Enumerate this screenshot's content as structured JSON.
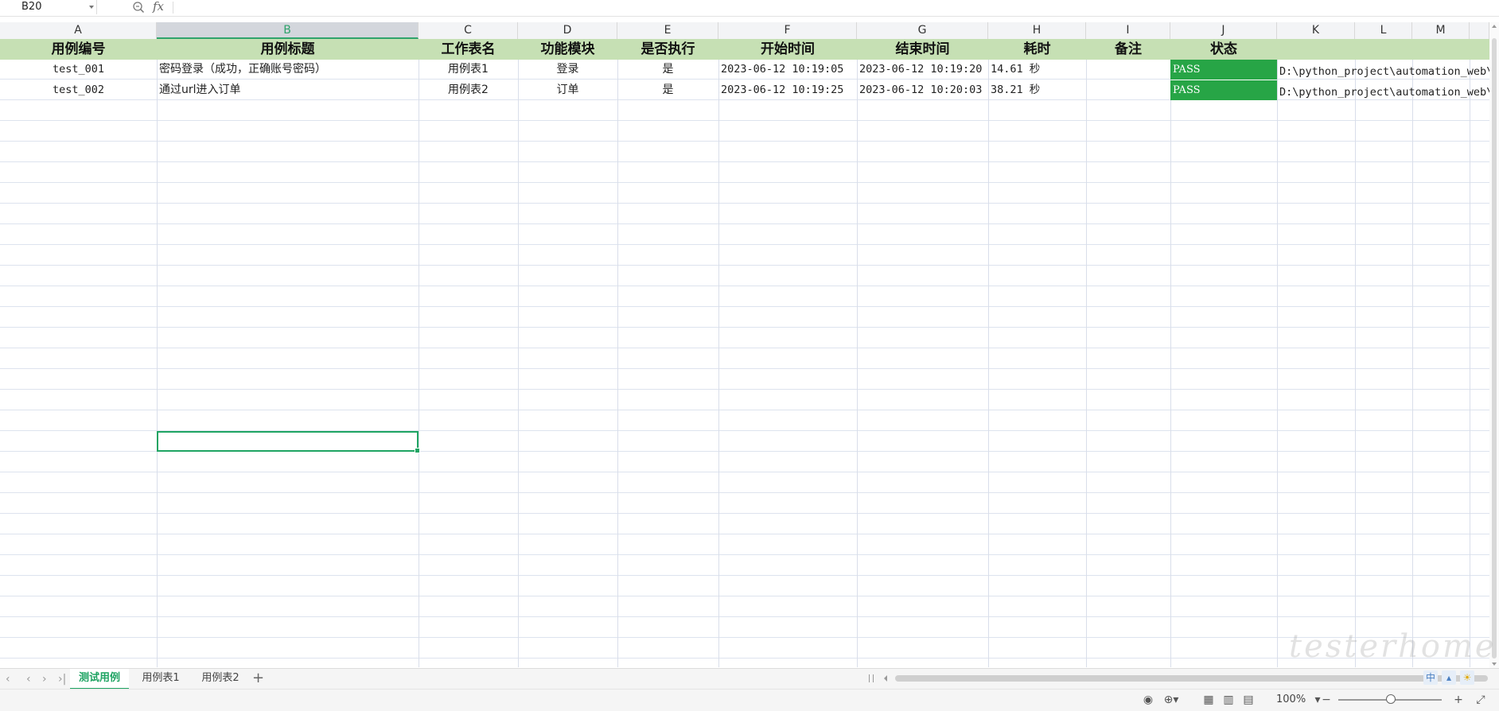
{
  "formula_bar": {
    "name_box": "B20",
    "fx_label": "fx",
    "formula": ""
  },
  "columns": [
    "A",
    "B",
    "C",
    "D",
    "E",
    "F",
    "G",
    "H",
    "I",
    "J",
    "K",
    "L",
    "M"
  ],
  "sheet": {
    "header": [
      "用例编号",
      "用例标题",
      "工作表名",
      "功能模块",
      "是否执行",
      "开始时间",
      "结束时间",
      "耗时",
      "备注",
      "状态"
    ],
    "rows": [
      {
        "id": "test_001",
        "title": "密码登录（成功，正确账号密码）",
        "sheet": "用例表1",
        "module": "登录",
        "execute": "是",
        "start": "2023-06-12 10:19:05",
        "end": "2023-06-12 10:19:20",
        "duration": "14.61 秒",
        "remark": "",
        "status": "PASS",
        "path": "D:\\python_project\\automation_web\\"
      },
      {
        "id": "test_002",
        "title": "通过url进入订单",
        "sheet": "用例表2",
        "module": "订单",
        "execute": "是",
        "start": "2023-06-12 10:19:25",
        "end": "2023-06-12 10:20:03",
        "duration": "38.21 秒",
        "remark": "",
        "status": "PASS",
        "path": "D:\\python_project\\automation_web\\"
      }
    ]
  },
  "tabs": [
    "测试用例",
    "用例表1",
    "用例表2"
  ],
  "add_tab": "+",
  "tray": {
    "ime": "中"
  },
  "status_bar": {
    "zoom": "100%"
  },
  "watermark": "testerhome.com",
  "colors": {
    "header_fill": "#c6e0b4",
    "pass_fill": "#27a546",
    "accent": "#1fa463"
  }
}
